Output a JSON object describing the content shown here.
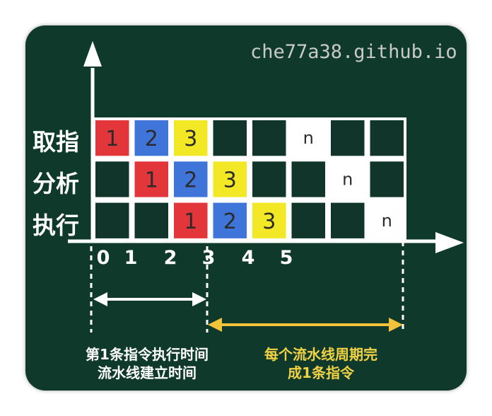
{
  "watermark": "che77a38.github.io",
  "rows": [
    {
      "label": "取指",
      "cells": [
        "1",
        "2",
        "3",
        "",
        "",
        "n",
        "",
        ""
      ]
    },
    {
      "label": "分析",
      "cells": [
        "",
        "1",
        "2",
        "3",
        "",
        "",
        "n",
        ""
      ]
    },
    {
      "label": "执行",
      "cells": [
        "",
        "",
        "1",
        "2",
        "3",
        "",
        "",
        "n"
      ]
    }
  ],
  "axis_ticks": [
    "0",
    "1",
    "2",
    "3",
    "4",
    "5"
  ],
  "notes": {
    "left": [
      "第1条指令执行时间",
      "流水线建立时间"
    ],
    "right": [
      "每个流水线周期完",
      "成1条指令"
    ]
  },
  "colors": {
    "board": "#0f3a2b",
    "grid_line": "#ffffff",
    "empty_cell": "#11352a",
    "cell_1": "#e3363b",
    "cell_2": "#3f74d9",
    "cell_3": "#f2e826",
    "cell_n": "#ffffff",
    "text_dark": "#2b2b2b",
    "arrow_white": "#ffffff",
    "arrow_yellow": "#f2c33a"
  }
}
